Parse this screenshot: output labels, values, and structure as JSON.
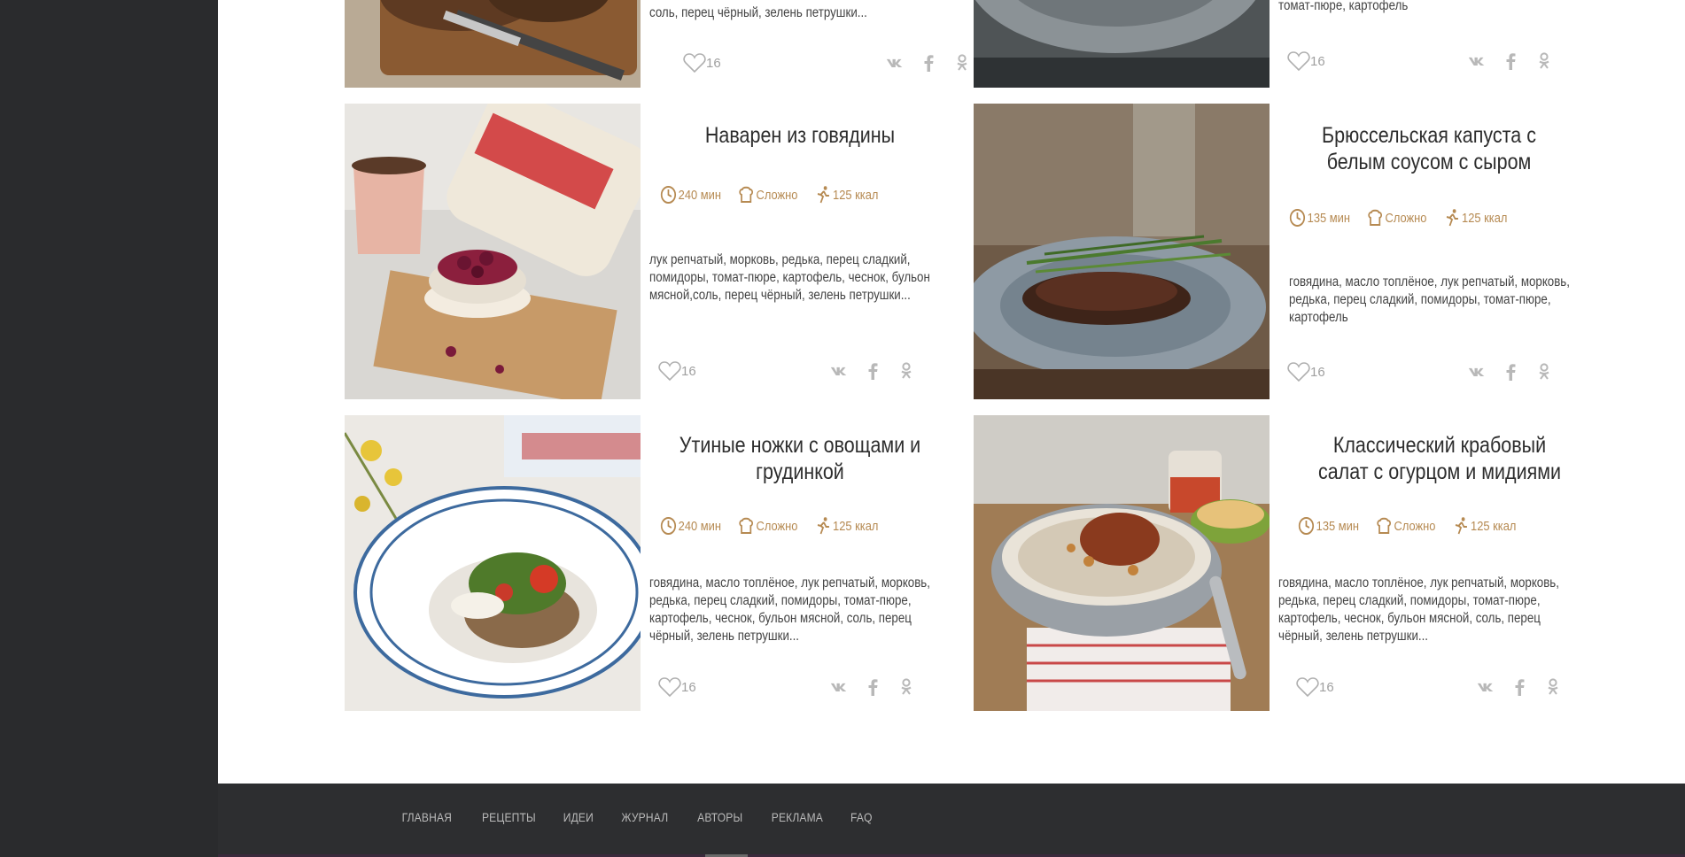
{
  "footer": {
    "nav": [
      "ГЛАВНАЯ",
      "РЕЦЕПТЫ",
      "ИДЕИ",
      "ЖУРНАЛ",
      "АВТОРЫ",
      "РЕКЛАМА",
      "FAQ"
    ]
  },
  "colors": {
    "accent": "#b68a52",
    "rail": "#2a2b2d",
    "footer": "#2d2e30"
  },
  "icons": {
    "time": "clock-icon",
    "difficulty": "chef-hat-icon",
    "calories": "runner-icon",
    "like": "heart-icon",
    "vk": "vk-icon",
    "fb": "facebook-icon",
    "ok": "odnoklassniki-icon"
  },
  "cards": [
    {
      "title": "",
      "desc": "соль, перец чёрный, зелень петрушки...",
      "likes": "16"
    },
    {
      "title": "",
      "desc": "томат-пюре, картофель",
      "likes": "16"
    },
    {
      "title": "Наварен из говядины",
      "time": "240 мин",
      "difficulty": "Сложно",
      "calories": "125 ккал",
      "desc": "лук репчатый, морковь, редька, перец сладкий, помидоры, томат-пюре, картофель, чеснок, бульон мясной,соль, перец чёрный, зелень петрушки...",
      "likes": "16"
    },
    {
      "title": "Брюссельская капуста с белым соусом с сыром",
      "time": "135 мин",
      "difficulty": "Сложно",
      "calories": "125 ккал",
      "desc": "говядина, масло топлёное, лук репчатый, морковь, редька, перец сладкий, помидоры, томат-пюре, картофель",
      "likes": "16"
    },
    {
      "title": "Утиные ножки с овощами и грудинкой",
      "time": "240 мин",
      "difficulty": "Сложно",
      "calories": "125 ккал",
      "desc": "говядина, масло топлёное, лук репчатый, морковь, редька, перец сладкий, помидоры, томат-пюре, картофель, чеснок, бульон мясной, соль, перец чёрный, зелень петрушки...",
      "likes": "16"
    },
    {
      "title": "Классический крабовый салат с огурцом и мидиями",
      "time": "135 мин",
      "difficulty": "Сложно",
      "calories": "125 ккал",
      "desc": "говядина, масло топлёное, лук репчатый, морковь, редька, перец сладкий, помидоры, томат-пюре, картофель, чеснок, бульон мясной, соль, перец чёрный, зелень петрушки...",
      "likes": "16"
    }
  ]
}
